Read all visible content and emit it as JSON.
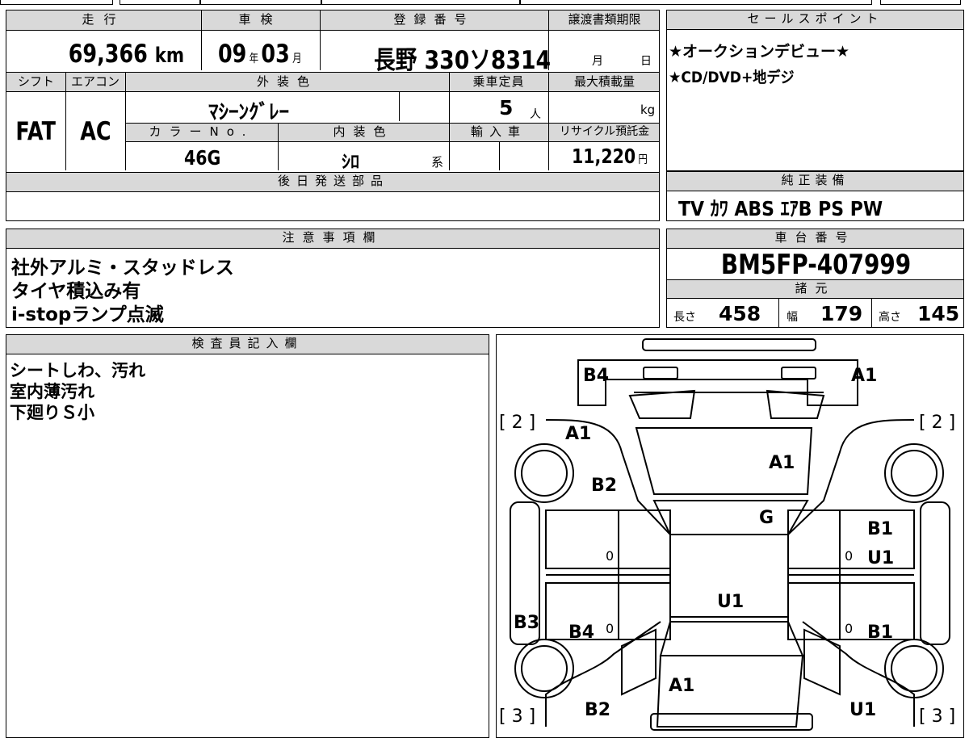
{
  "mileage": {
    "label": "走行",
    "value": "69,366",
    "unit": "km"
  },
  "inspection": {
    "label": "車検",
    "year": "09",
    "year_unit": "年",
    "month": "03",
    "month_unit": "月"
  },
  "registration": {
    "label": "登録番号",
    "value": "長野 330ソ8314"
  },
  "transfer_deadline": {
    "label": "譲渡書類期限",
    "month_unit": "月",
    "day_unit": "日"
  },
  "shift": {
    "label": "シフト",
    "value": "FAT"
  },
  "aircon": {
    "label": "エアコン",
    "value": "AC"
  },
  "exterior_color": {
    "label": "外装色",
    "value": "ﾏｼｰﾝｸﾞﾚｰ"
  },
  "capacity": {
    "label": "乗車定員",
    "value": "5",
    "unit": "人"
  },
  "max_load": {
    "label": "最大積載量",
    "unit": "kg"
  },
  "color_no": {
    "label": "カラーNo.",
    "value": "46G"
  },
  "interior_color": {
    "label": "内装色",
    "value": "ｼﾛ",
    "suffix": "系"
  },
  "import": {
    "label": "輸入車"
  },
  "recycle": {
    "label": "リサイクル預託金",
    "value": "11,220",
    "unit": "円"
  },
  "later_parts": {
    "label": "後日発送部品"
  },
  "sales_points": {
    "label": "セールスポイント",
    "items": [
      "★オークションデビュー★",
      "★CD/DVD+地デジ"
    ]
  },
  "equipment": {
    "label": "純正装備",
    "value": "TV ｶﾜ ABS ｴｱB PS PW"
  },
  "notes": {
    "label": "注意事項欄",
    "lines": [
      "社外アルミ・スタッドレス",
      "タイヤ積込み有",
      "i-stopランプ点滅"
    ]
  },
  "chassis": {
    "label": "車台番号",
    "value": "BM5FP-407999"
  },
  "specs": {
    "label": "諸元",
    "length_label": "長さ",
    "length": "458",
    "width_label": "幅",
    "width": "179",
    "height_label": "高さ",
    "height": "145"
  },
  "inspector": {
    "label": "検査員記入欄",
    "lines": [
      "シートしわ、汚れ",
      "室内薄汚れ",
      "下廻りＳ小"
    ]
  },
  "diagram": {
    "marks": {
      "rear_left": "B4",
      "rear_right": "A1",
      "left_rear_quarter": "A1",
      "trunk": "A1",
      "left_rear_fender": "B2",
      "roof_glass": "G",
      "right_door_upper": "B1",
      "right_door_upper2": "U1",
      "roof": "U1",
      "left_body": "B3",
      "left_door": "B4",
      "right_door_lower": "B1",
      "hood": "A1",
      "left_front": "B2",
      "right_front": "U1"
    },
    "tire_left_top": "[ 2 ]",
    "tire_right_top": "[ 2 ]",
    "tire_left_bottom": "[ 3 ]",
    "tire_right_bottom": "[ 3 ]",
    "zero": "0"
  }
}
